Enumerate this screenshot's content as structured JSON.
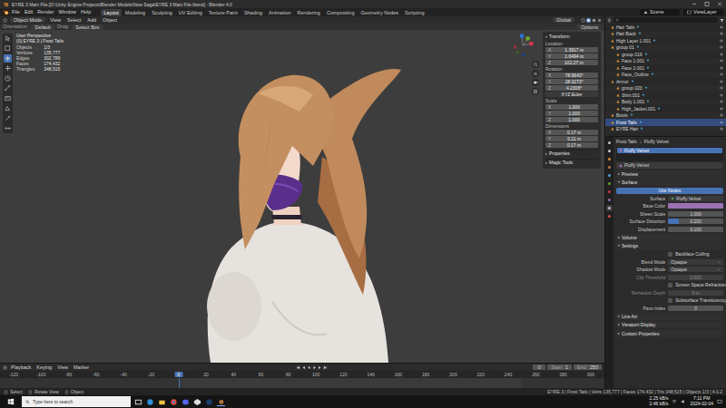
{
  "window": {
    "title": "EYRE 3 Main File [D:\\Unity Engine Projects\\Blender Models\\New Saga\\EYRE 3 Main File.blend] - Blender 4.0"
  },
  "menu": [
    "File",
    "Edit",
    "Render",
    "Window",
    "Help"
  ],
  "workspaces": [
    {
      "label": "Layout",
      "selected": true
    },
    {
      "label": "Modeling",
      "selected": false
    },
    {
      "label": "Sculpting",
      "selected": false
    },
    {
      "label": "UV Editing",
      "selected": false
    },
    {
      "label": "Texture Paint",
      "selected": false
    },
    {
      "label": "Shading",
      "selected": false
    },
    {
      "label": "Animation",
      "selected": false
    },
    {
      "label": "Rendering",
      "selected": false
    },
    {
      "label": "Compositing",
      "selected": false
    },
    {
      "label": "Geometry Nodes",
      "selected": false
    },
    {
      "label": "Scripting",
      "selected": false
    }
  ],
  "scene": "Scene",
  "view_layer": "ViewLayer",
  "viewport_header": {
    "mode": "Object Mode",
    "menus": [
      "View",
      "Select",
      "Add",
      "Object"
    ],
    "orientation": "Global"
  },
  "tool_header": {
    "orientation_label": "Orientation:",
    "orientation": "Default",
    "drag_label": "Drag:",
    "drag": "Select Box",
    "options": "Options"
  },
  "overlay_info": [
    "User Perspective",
    "(0) EYRE 3 | Frost Tails"
  ],
  "stats": [
    {
      "label": "Objects",
      "value": "1/3"
    },
    {
      "label": "Vertices",
      "value": "135,777"
    },
    {
      "label": "Edges",
      "value": "302,789"
    },
    {
      "label": "Faces",
      "value": "174,432"
    },
    {
      "label": "Triangles",
      "value": "348,515"
    }
  ],
  "toolbar": {
    "tools": [
      {
        "selected": false
      },
      {
        "selected": false
      },
      {
        "selected": true
      },
      {
        "selected": false
      },
      {
        "selected": false
      },
      {
        "selected": false
      },
      {
        "selected": false
      },
      {
        "selected": false
      },
      {
        "selected": false
      },
      {
        "selected": false
      }
    ]
  },
  "n_panel": {
    "title": "Transform",
    "expanded": true,
    "groups": [
      {
        "kind": "vector",
        "label": "Location",
        "fields": [
          {
            "axis": "X",
            "value": "1.3917 m"
          },
          {
            "axis": "Y",
            "value": "1.6494 m"
          },
          {
            "axis": "Z",
            "value": "102.27 m"
          }
        ]
      },
      {
        "kind": "vector",
        "label": "Rotation",
        "fields": [
          {
            "axis": "X",
            "value": "78.9643°"
          },
          {
            "axis": "Y",
            "value": "28.3273°"
          },
          {
            "axis": "Z",
            "value": "4.2308°"
          }
        ]
      },
      {
        "kind": "dropdown",
        "value": "XYZ Euler"
      },
      {
        "kind": "vector",
        "label": "Scale",
        "fields": [
          {
            "axis": "X",
            "value": "1.000"
          },
          {
            "axis": "Y",
            "value": "1.000"
          },
          {
            "axis": "Z",
            "value": "1.000"
          }
        ]
      },
      {
        "kind": "vector",
        "label": "Dimensions",
        "fields": [
          {
            "axis": "X",
            "value": "0.17 m"
          },
          {
            "axis": "Y",
            "value": "0.11 m"
          },
          {
            "axis": "Z",
            "value": "0.17 m"
          }
        ]
      }
    ],
    "sections": [
      {
        "title": "Properties",
        "expanded": false
      },
      {
        "title": "Magic Tools",
        "expanded": false
      }
    ]
  },
  "outliner": {
    "rows": [
      {
        "label": "Hair Tails",
        "depth": 1,
        "selected": false
      },
      {
        "label": "Hair Back",
        "depth": 1,
        "selected": false
      },
      {
        "label": "High Layer 1.001",
        "depth": 1,
        "selected": false
      },
      {
        "label": "group 01",
        "depth": 1,
        "selected": false
      },
      {
        "label": "group 019",
        "depth": 2,
        "selected": false
      },
      {
        "label": "Face 1.001",
        "depth": 2,
        "selected": false
      },
      {
        "label": "Face 2.001",
        "depth": 2,
        "selected": false
      },
      {
        "label": "Face_Outline",
        "depth": 2,
        "selected": false
      },
      {
        "label": "Armor",
        "depth": 1,
        "selected": false
      },
      {
        "label": "group 020",
        "depth": 2,
        "selected": false
      },
      {
        "label": "Shirt.001",
        "depth": 2,
        "selected": false
      },
      {
        "label": "Body 1.001",
        "depth": 2,
        "selected": false
      },
      {
        "label": "High_Jacket.001",
        "depth": 2,
        "selected": false
      },
      {
        "label": "Boots",
        "depth": 1,
        "selected": false
      },
      {
        "label": "Frost Tails",
        "depth": 1,
        "selected": true
      },
      {
        "label": "EYRE Hair",
        "depth": 1,
        "selected": false
      }
    ]
  },
  "properties": {
    "breadcrumb": [
      "Frost Tails",
      "Fluffy Velvet"
    ],
    "slots": [
      {
        "label": "Fluffy Velvet",
        "selected": true
      }
    ],
    "material": "Fluffy Velvet",
    "sections": [
      {
        "title": "Preview",
        "expanded": false,
        "rows": []
      },
      {
        "title": "Surface",
        "expanded": true,
        "rows": [
          {
            "kind": "button",
            "label": "Use Nodes",
            "on": true,
            "disabled": false
          },
          {
            "kind": "link",
            "label": "Surface",
            "value": "Fluffy Velvet",
            "disabled": false
          },
          {
            "kind": "color",
            "label": "Base Color",
            "color": "#9a72b4",
            "disabled": false
          },
          {
            "kind": "number",
            "label": "Sheen Scale",
            "value": "1.000",
            "disabled": false
          },
          {
            "kind": "slider",
            "label": "Surface Distortion",
            "value": "0.200",
            "level": 0.2,
            "disabled": false
          },
          {
            "kind": "number",
            "label": "Displacement",
            "value": "0.100",
            "disabled": false
          }
        ]
      },
      {
        "title": "Volume",
        "expanded": false,
        "rows": []
      },
      {
        "title": "Settings",
        "expanded": true,
        "rows": [
          {
            "kind": "checkbox",
            "label": "Backface Culling",
            "checked": false,
            "disabled": false
          },
          {
            "kind": "dropdown",
            "label": "Blend Mode",
            "value": "Opaque",
            "disabled": false
          },
          {
            "kind": "dropdown",
            "label": "Shadow Mode",
            "value": "Opaque",
            "disabled": false
          },
          {
            "kind": "number",
            "label": "Clip Threshold",
            "value": "0.500",
            "disabled": true
          },
          {
            "kind": "checkbox",
            "label": "Screen Space Refraction",
            "checked": false,
            "disabled": false
          },
          {
            "kind": "number",
            "label": "Refraction Depth",
            "value": "0 m",
            "disabled": true
          },
          {
            "kind": "checkbox",
            "label": "Subsurface Translucency",
            "checked": false,
            "disabled": false
          },
          {
            "kind": "number",
            "label": "Pass Index",
            "value": "0",
            "disabled": false
          }
        ]
      },
      {
        "title": "Line Art",
        "expanded": false,
        "rows": []
      },
      {
        "title": "Viewport Display",
        "expanded": false,
        "rows": []
      },
      {
        "title": "Custom Properties",
        "expanded": false,
        "rows": []
      }
    ]
  },
  "timeline": {
    "menus": [
      "Playback",
      "Keying",
      "View",
      "Marker"
    ],
    "current_frame": "0",
    "start_label": "Start",
    "start": "1",
    "end_label": "End",
    "end": "250",
    "ticks": [
      "-120",
      "-100",
      "-80",
      "-60",
      "-40",
      "-20",
      "20",
      "40",
      "60",
      "80",
      "100",
      "120",
      "140",
      "160",
      "180",
      "200",
      "220",
      "240",
      "260",
      "280",
      "300"
    ]
  },
  "status_bar": {
    "hints": [
      "Select",
      "Rotate View",
      "Object"
    ],
    "info": "EYRE 3 | Frost Tails | Verts 135,777 | Faces 174,432 | Tris 348,515 | Objects 1/3 | 4.0.2"
  },
  "taskbar": {
    "search_placeholder": "Type here to search",
    "net_up": "2.25 kB/s",
    "net_down": "2.46 kB/s",
    "time": "7:11 PM",
    "date": "2024-02-04"
  }
}
